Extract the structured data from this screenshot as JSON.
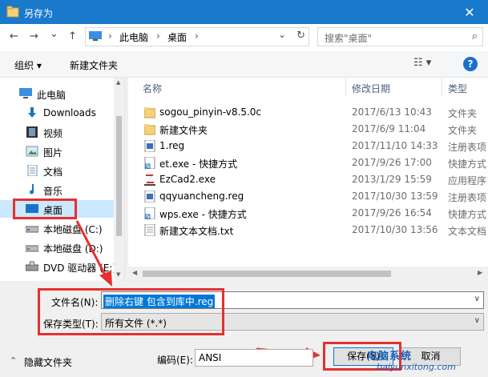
{
  "window": {
    "title": "另存为",
    "close_glyph": "✕"
  },
  "nav": {
    "back_glyph": "←",
    "forward_glyph": "→",
    "recent_glyph": "⌄",
    "up_glyph": "↑",
    "breadcrumb": [
      "此电脑",
      "桌面"
    ],
    "crumb_sep": "›",
    "addr_dropdown_glyph": "⌄",
    "refresh_glyph": "↻",
    "search_placeholder": "搜索\"桌面\"",
    "search_glyph": "⌕"
  },
  "toolbar": {
    "organize_label": "组织 ▾",
    "new_folder_label": "新建文件夹",
    "view_glyph": "☷ ▾",
    "help_glyph": "?"
  },
  "sidebar": {
    "items": [
      {
        "label": "此电脑",
        "icon": "computer-icon"
      },
      {
        "label": "Downloads",
        "icon": "download-icon"
      },
      {
        "label": "视频",
        "icon": "video-icon"
      },
      {
        "label": "图片",
        "icon": "picture-icon"
      },
      {
        "label": "文档",
        "icon": "document-icon"
      },
      {
        "label": "音乐",
        "icon": "music-icon"
      },
      {
        "label": "桌面",
        "icon": "desktop-icon"
      },
      {
        "label": "本地磁盘 (C:)",
        "icon": "drive-icon"
      },
      {
        "label": "本地磁盘 (D:)",
        "icon": "drive-icon"
      },
      {
        "label": "DVD 驱动器 (E:)",
        "icon": "dvd-icon"
      }
    ]
  },
  "files": {
    "columns": [
      "名称",
      "修改日期",
      "类型"
    ],
    "rows": [
      {
        "name": "sogou_pinyin-v8.5.0c",
        "date": "2017/6/13 10:43",
        "type": "文件夹",
        "icon": "folder-icon"
      },
      {
        "name": "新建文件夹",
        "date": "2017/6/9 11:04",
        "type": "文件夹",
        "icon": "folder-icon"
      },
      {
        "name": "1.reg",
        "date": "2017/11/10 14:33",
        "type": "注册表项",
        "icon": "reg-icon"
      },
      {
        "name": "et.exe - 快捷方式",
        "date": "2017/9/26 17:00",
        "type": "快捷方式",
        "icon": "shortcut-icon"
      },
      {
        "name": "EzCad2.exe",
        "date": "2013/1/29 15:59",
        "type": "应用程序",
        "icon": "ezcad-icon"
      },
      {
        "name": "qqyuancheng.reg",
        "date": "2017/10/30 13:59",
        "type": "注册表项",
        "icon": "reg-icon"
      },
      {
        "name": "wps.exe - 快捷方式",
        "date": "2017/9/26 16:54",
        "type": "快捷方式",
        "icon": "shortcut-icon"
      },
      {
        "name": "新建文本文档.txt",
        "date": "2017/10/30 13:56",
        "type": "文本文档",
        "icon": "txt-icon"
      }
    ]
  },
  "save": {
    "filename_label": "文件名(N):",
    "filename_value": "删除右键 包含到库中.reg",
    "savetype_label": "保存类型(T):",
    "savetype_value": "所有文件  (*.*)",
    "hide_folders_label": "隐藏文件夹",
    "hide_glyph": "⌃",
    "encoding_label": "编码(E):",
    "encoding_value": "ANSI",
    "save_button": "保存(S)",
    "cancel_button": "取消",
    "dropdown_glyph": "∨"
  },
  "watermark": {
    "line1": "电脑系统",
    "line2": "baiyunxitong.com"
  },
  "colors": {
    "titlebar": "#1979ca",
    "selection": "#0078d7",
    "highlight_box": "#e53030",
    "sidebar_selected": "#cce8ff"
  }
}
